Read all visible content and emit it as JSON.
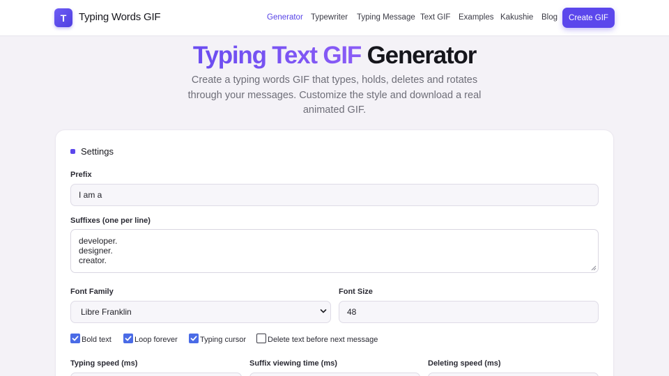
{
  "header": {
    "logo_letter": "T",
    "brand": "Typing Words GIF",
    "nav": [
      {
        "label": "Generator",
        "active": true
      },
      {
        "label": "Typewriter",
        "active": false
      },
      {
        "label": "Typing Message",
        "active": false
      },
      {
        "label": "Text GIF",
        "active": false
      },
      {
        "label": "Examples",
        "active": false
      },
      {
        "label": "Kakushie",
        "active": false
      },
      {
        "label": "Blog",
        "active": false
      }
    ],
    "cta_label": "Create GIF"
  },
  "hero": {
    "title_accent": "Typing Text GIF",
    "title_rest": "Generator",
    "subtitle": "Create a typing words GIF that types, holds, deletes and rotates through your messages. Customize the style and download a real animated GIF."
  },
  "settings": {
    "title": "Settings",
    "prefix": {
      "label": "Prefix",
      "value": "I am a"
    },
    "suffixes": {
      "label": "Suffixes (one per line)",
      "lines": [
        "developer.",
        "designer.",
        "creator."
      ]
    },
    "font_family": {
      "label": "Font Family",
      "value": "Libre Franklin"
    },
    "font_size": {
      "label": "Font Size",
      "value": "48"
    },
    "options": [
      {
        "label": "Bold text",
        "checked": true
      },
      {
        "label": "Loop forever",
        "checked": true
      },
      {
        "label": "Typing cursor",
        "checked": true
      },
      {
        "label": "Delete text before next message",
        "checked": false
      }
    ],
    "typing_speed": {
      "label": "Typing speed (ms)"
    },
    "suffix_viewing_time": {
      "label": "Suffix viewing time (ms)"
    },
    "deleting_speed": {
      "label": "Deleting speed (ms)"
    }
  },
  "colors": {
    "accent": "#5b47ec",
    "active_nav": "#5642e6",
    "checkbox": "#4a6be6",
    "background": "#f4f2f7"
  },
  "icons": {
    "logo": "letter-badge",
    "select_chevron": "chevron-down-icon",
    "checkbox": "checkmark-icon"
  }
}
